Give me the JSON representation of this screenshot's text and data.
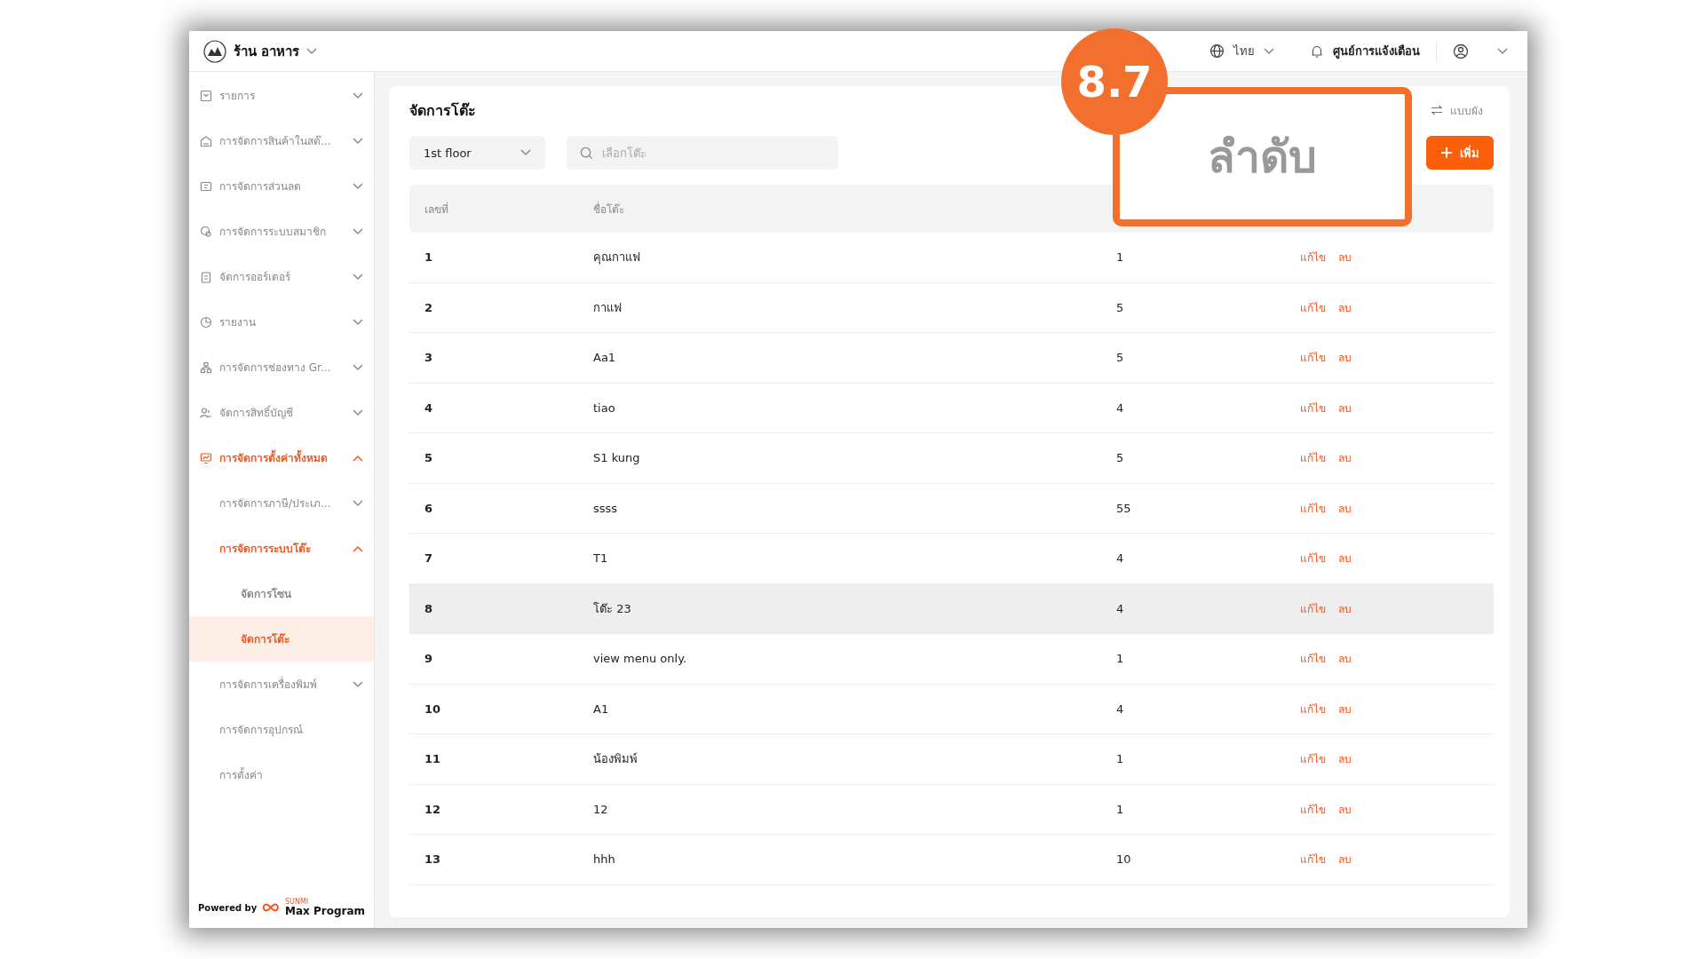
{
  "topbar": {
    "store_name": "ร้าน อาหาร",
    "language": "ไทย",
    "notifications": "ศูนย์การแจ้งเตือน"
  },
  "sidebar": {
    "items": [
      {
        "label": "รายการ",
        "expanded": false,
        "selected": false
      },
      {
        "label": "การจัดการสินค้าในสต๊...",
        "expanded": false,
        "selected": false
      },
      {
        "label": "การจัดการส่วนลด",
        "expanded": false,
        "selected": false
      },
      {
        "label": "การจัดการระบบสมาชิก",
        "expanded": false,
        "selected": false
      },
      {
        "label": "จัดการออร์เดอร์",
        "expanded": false,
        "selected": false
      },
      {
        "label": "รายงาน",
        "expanded": false,
        "selected": false
      },
      {
        "label": "การจัดการช่องทาง Gr...",
        "expanded": false,
        "selected": false
      },
      {
        "label": "จัดการสิทธิ์บัญชี",
        "expanded": false,
        "selected": false
      },
      {
        "label": "การจัดการตั้งค่าทั้งหมด",
        "expanded": true,
        "selected": true,
        "children": [
          {
            "label": "การจัดการภาษี/ประเภ...",
            "expanded": false,
            "selected": false
          },
          {
            "label": "การจัดการระบบโต๊ะ",
            "expanded": true,
            "selected": true,
            "children": [
              {
                "label": "จัดการโซน",
                "selected": false
              },
              {
                "label": "จัดการโต๊ะ",
                "selected": true
              }
            ]
          },
          {
            "label": "การจัดการเครื่องพิมพ์",
            "expanded": false,
            "selected": false
          },
          {
            "label": "การจัดการอุปกรณ์",
            "selected": false
          },
          {
            "label": "การตั้งค่า",
            "selected": false
          }
        ]
      }
    ],
    "footer": {
      "powered_by": "Powered by",
      "brand_small": "SUNMI",
      "brand": "Max Program"
    }
  },
  "page": {
    "title": "จัดการโต๊ะ",
    "layout_toggle": "แบบผัง",
    "floor": "1st floor",
    "search": {
      "placeholder": "เลือกโต๊ะ"
    },
    "add_button": "เพิ่ม"
  },
  "table": {
    "columns": [
      "เลขที่",
      "ชื่อโต๊ะ"
    ],
    "rows": [
      {
        "number": "1",
        "name": "คุณกาแฟ",
        "column_3": "1",
        "actions": [
          "แก้ไข",
          "ลบ"
        ],
        "hovered": false
      },
      {
        "number": "2",
        "name": "กาแฟ",
        "column_3": "5",
        "actions": [
          "แก้ไข",
          "ลบ"
        ],
        "hovered": false
      },
      {
        "number": "3",
        "name": "Aa1",
        "column_3": "5",
        "actions": [
          "แก้ไข",
          "ลบ"
        ],
        "hovered": false
      },
      {
        "number": "4",
        "name": "tiao",
        "column_3": "4",
        "actions": [
          "แก้ไข",
          "ลบ"
        ],
        "hovered": false
      },
      {
        "number": "5",
        "name": "S1 kung",
        "column_3": "5",
        "actions": [
          "แก้ไข",
          "ลบ"
        ],
        "hovered": false
      },
      {
        "number": "6",
        "name": "ssss",
        "column_3": "55",
        "actions": [
          "แก้ไข",
          "ลบ"
        ],
        "hovered": false
      },
      {
        "number": "7",
        "name": "T1",
        "column_3": "4",
        "actions": [
          "แก้ไข",
          "ลบ"
        ],
        "hovered": false
      },
      {
        "number": "8",
        "name": "โต๊ะ 23",
        "column_3": "4",
        "actions": [
          "แก้ไข",
          "ลบ"
        ],
        "hovered": true
      },
      {
        "number": "9",
        "name": "view menu only.",
        "column_3": "1",
        "actions": [
          "แก้ไข",
          "ลบ"
        ],
        "hovered": false
      },
      {
        "number": "10",
        "name": "A1",
        "column_3": "4",
        "actions": [
          "แก้ไข",
          "ลบ"
        ],
        "hovered": false
      },
      {
        "number": "11",
        "name": "น้องพิมพ์",
        "column_3": "1",
        "actions": [
          "แก้ไข",
          "ลบ"
        ],
        "hovered": false
      },
      {
        "number": "12",
        "name": "12",
        "column_3": "1",
        "actions": [
          "แก้ไข",
          "ลบ"
        ],
        "hovered": false
      },
      {
        "number": "13",
        "name": "hhh",
        "column_3": "10",
        "actions": [
          "แก้ไข",
          "ลบ"
        ],
        "hovered": false
      }
    ]
  },
  "callout": {
    "step": "8.7",
    "text": "ลำดับ"
  }
}
